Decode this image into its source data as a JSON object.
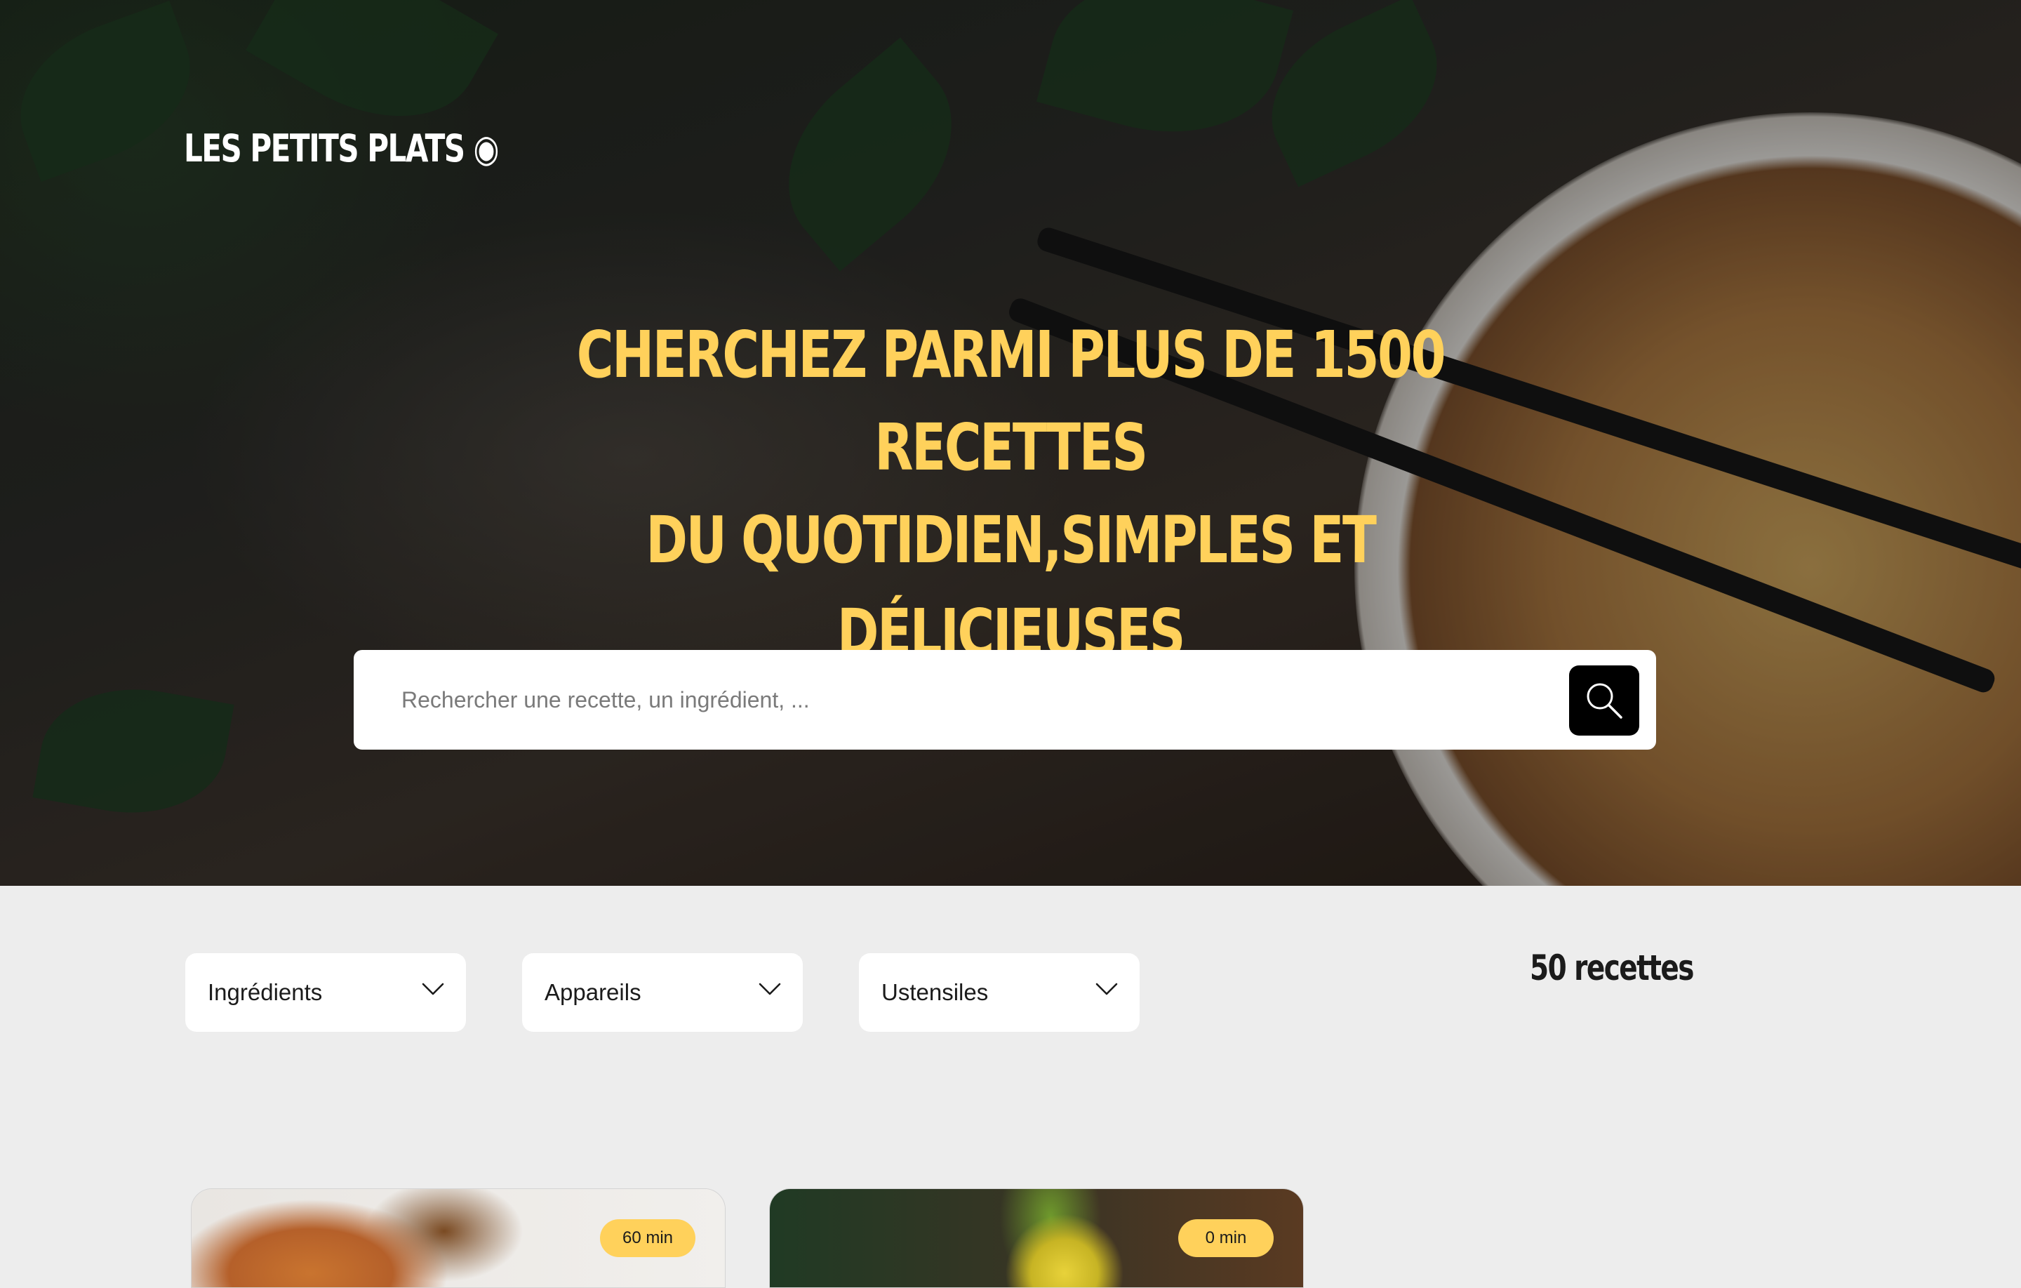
{
  "header": {
    "logo": "LES PETITS PLATS ◉",
    "headline_line1": "CHERCHEZ PARMI PLUS DE 1500 RECETTES",
    "headline_line2": "DU QUOTIDIEN,SIMPLES ET DÉLICIEUSES"
  },
  "search": {
    "placeholder": "Rechercher une recette, un ingrédient, ...",
    "button_icon": "search-icon"
  },
  "filters": [
    {
      "label": "Ingrédients",
      "icon": "chevron-down-icon"
    },
    {
      "label": "Appareils",
      "icon": "chevron-down-icon"
    },
    {
      "label": "Ustensiles",
      "icon": "chevron-down-icon"
    }
  ],
  "results": {
    "count_label": "50 recettes"
  },
  "recipes": [
    {
      "time": "60 min"
    },
    {
      "time": "0 min"
    }
  ],
  "colors": {
    "accent": "#ffd15b",
    "background": "#ededed",
    "search_button": "#000000"
  }
}
